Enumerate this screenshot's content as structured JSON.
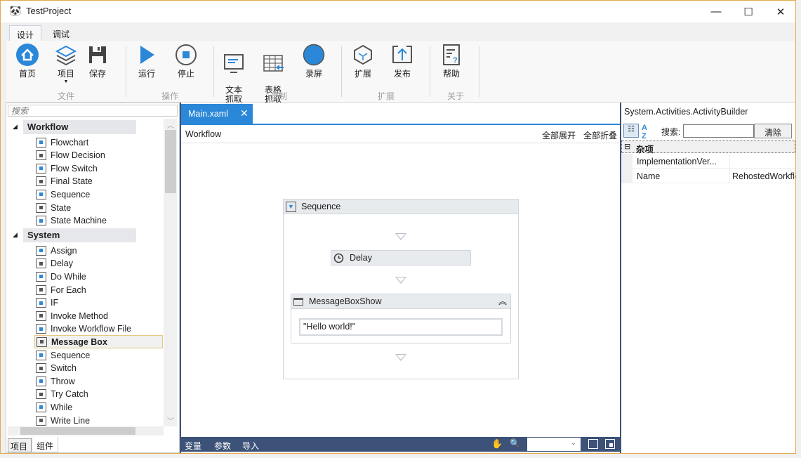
{
  "window": {
    "title": "TestProject",
    "minimize": "—",
    "maximize": "☐",
    "close": "✕"
  },
  "ribbon_tabs": [
    {
      "label": "设计",
      "active": true
    },
    {
      "label": "调试",
      "active": false
    }
  ],
  "ribbon": {
    "buttons": {
      "home": "首页",
      "project": "项目",
      "save": "保存",
      "run": "运行",
      "stop": "停止",
      "text_capture": "文本\n抓取",
      "table_capture": "表格\n抓取",
      "record": "录屏",
      "extend": "扩展",
      "publish": "发布",
      "help": "帮助"
    },
    "groups": {
      "file": "文件",
      "ops": "操作",
      "record": "录制",
      "extend": "扩展",
      "about": "关于"
    },
    "accent": "#2b87d8"
  },
  "toolbox": {
    "search_placeholder": "搜索",
    "categories": [
      {
        "label": "Workflow",
        "items": [
          "Flowchart",
          "Flow Decision",
          "Flow Switch",
          "Final State",
          "Sequence",
          "State",
          "State Machine"
        ]
      },
      {
        "label": "System",
        "items": [
          "Assign",
          "Delay",
          "Do While",
          "For Each",
          "IF",
          "Invoke Method",
          "Invoke Workflow File",
          "Message Box",
          "Sequence",
          "Switch",
          "Throw",
          "Try Catch",
          "While",
          "Write Line"
        ]
      }
    ],
    "selected": "Message Box",
    "bottom_tabs": [
      {
        "label": "项目",
        "active": false
      },
      {
        "label": "组件",
        "active": true
      }
    ]
  },
  "designer": {
    "tab": "Main.xaml",
    "breadcrumb": "Workflow",
    "expand_all": "全部展开",
    "collapse_all": "全部折叠",
    "sequence": {
      "title": "Sequence",
      "delay": "Delay",
      "msgbox": {
        "title": "MessageBoxShow",
        "value": "\"Hello world!\""
      }
    },
    "bottom": {
      "variables": "变量",
      "arguments": "参数",
      "imports": "导入",
      "zoom_value": ""
    }
  },
  "properties": {
    "title": "System.Activities.ActivityBuilder",
    "search_label": "搜索:",
    "search_value": "",
    "clear": "清除",
    "category": "杂项",
    "rows": [
      {
        "name": "ImplementationVer...",
        "value": ""
      },
      {
        "name": "Name",
        "value": "RehostedWorkflow"
      }
    ]
  }
}
